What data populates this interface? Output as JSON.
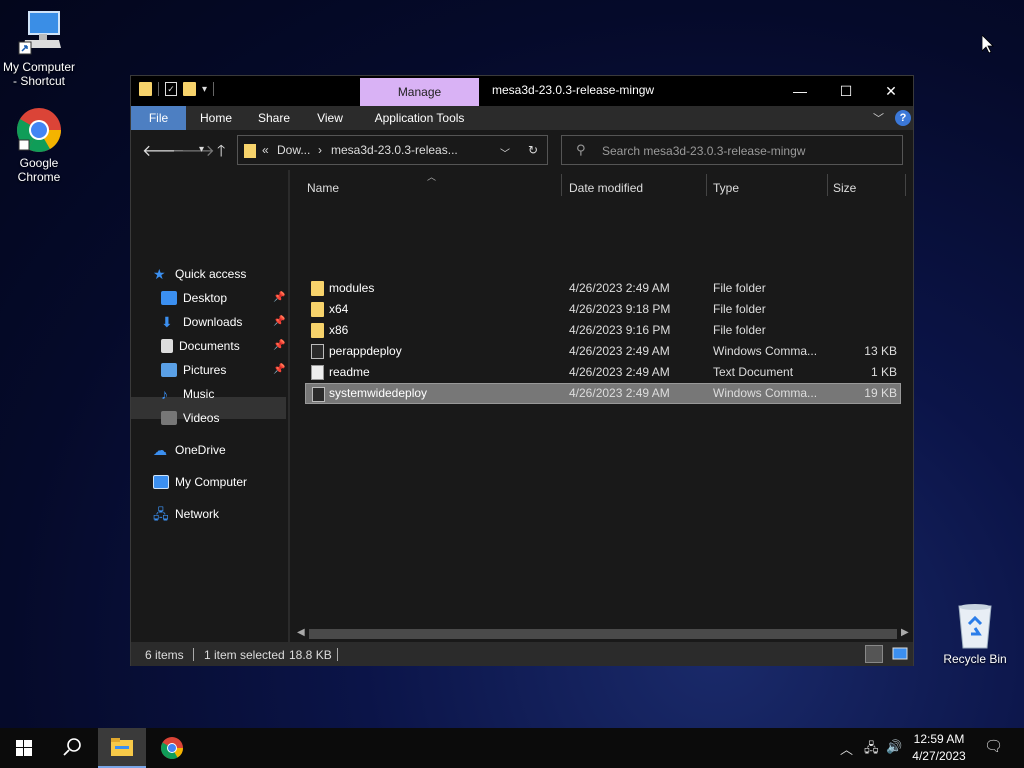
{
  "desktop": {
    "icons": [
      {
        "label": "My Computer\n- Shortcut",
        "line1": "My Computer",
        "line2": "- Shortcut"
      },
      {
        "label": "Google Chrome",
        "line1": "Google",
        "line2": "Chrome"
      },
      {
        "label": "Recycle Bin"
      }
    ]
  },
  "window": {
    "title": "mesa3d-23.0.3-release-mingw",
    "contextual_tab": "Manage",
    "ribbon_tabs": [
      "File",
      "Home",
      "Share",
      "View",
      "Application Tools"
    ],
    "help": "?"
  },
  "address": {
    "crumbs": [
      "«",
      "Dow...",
      "›",
      "mesa3d-23.0.3-releas...",
      "›"
    ],
    "search_placeholder": "Search mesa3d-23.0.3-release-mingw"
  },
  "nav": {
    "items": [
      {
        "label": "Quick access"
      },
      {
        "label": "Desktop"
      },
      {
        "label": "Downloads"
      },
      {
        "label": "Documents"
      },
      {
        "label": "Pictures"
      },
      {
        "label": "Music"
      },
      {
        "label": "Videos"
      },
      {
        "label": "OneDrive"
      },
      {
        "label": "My Computer"
      },
      {
        "label": "Network"
      }
    ]
  },
  "columns": [
    "Name",
    "Date modified",
    "Type",
    "Size"
  ],
  "files": [
    {
      "name": "modules",
      "date": "4/26/2023 2:49 AM",
      "type": "File folder",
      "size": ""
    },
    {
      "name": "x64",
      "date": "4/26/2023 9:18 PM",
      "type": "File folder",
      "size": ""
    },
    {
      "name": "x86",
      "date": "4/26/2023 9:16 PM",
      "type": "File folder",
      "size": ""
    },
    {
      "name": "perappdeploy",
      "date": "4/26/2023 2:49 AM",
      "type": "Windows Comma...",
      "size": "13 KB"
    },
    {
      "name": "readme",
      "date": "4/26/2023 2:49 AM",
      "type": "Text Document",
      "size": "1 KB"
    },
    {
      "name": "systemwidedeploy",
      "date": "4/26/2023 2:49 AM",
      "type": "Windows Comma...",
      "size": "19 KB"
    }
  ],
  "status": {
    "items": "6 items",
    "selected": "1 item selected",
    "size": "18.8 KB"
  },
  "taskbar": {
    "time": "12:59 AM",
    "date": "4/27/2023"
  },
  "colors": {
    "file_tab": "#4d7fc2",
    "manage_tab": "#d9b2f5",
    "folder": "#f7d36b"
  }
}
